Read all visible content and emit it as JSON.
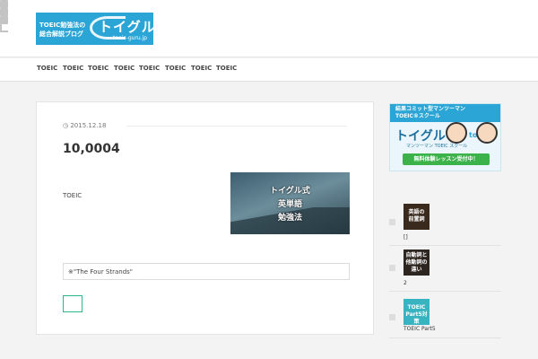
{
  "header": {
    "logo_line1": "TOEIC勉強法の",
    "logo_line2": "総合解説ブログ",
    "logo_brand": "トイグル",
    "logo_url": "toeic-guru.jp",
    "social": [
      "facebook-icon",
      "twitter-icon",
      "googleplus-icon",
      "rss-icon"
    ]
  },
  "nav": {
    "items": [
      "TOEIC",
      "TOEIC",
      "TOEIC",
      "TOEIC",
      "TOEIC",
      "TOEIC",
      "TOEIC",
      "TOEIC"
    ]
  },
  "article": {
    "date": "2015.12.18",
    "title": "10,0004",
    "paragraph": "TOEIC",
    "thumb_lines": [
      "トイグル式",
      "英単語",
      "勉強法"
    ],
    "quote": "※\"The Four Strands\""
  },
  "ad": {
    "top_line1": "結果コミット型マンツーマン",
    "top_line2": "TOEIC®スクール",
    "brand": "トイグル",
    "sub": "マンツーマン TOEIC スクール",
    "to": "to",
    "cta": "無料体験レッスン受付中！"
  },
  "sidebar": {
    "items": [
      {
        "image_lines": [
          "英語の",
          "前置詞"
        ],
        "caption": "[]",
        "image_color": "#3a2a1e"
      },
      {
        "image_lines": [
          "自動詞と",
          "他動詞の",
          "違い"
        ],
        "caption": "2",
        "image_color": "#2d2520"
      },
      {
        "image_lines": [
          "TOEIC",
          "Part5対策"
        ],
        "caption": "TOEIC Part5",
        "image_color": "#38b3c0"
      }
    ]
  }
}
